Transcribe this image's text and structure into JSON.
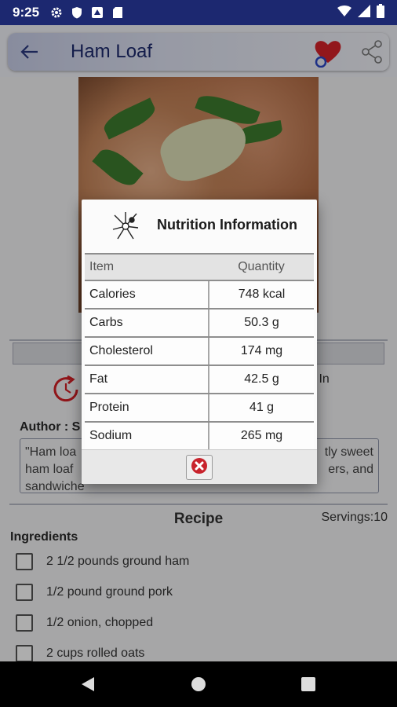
{
  "status": {
    "time": "9:25",
    "icons": [
      "settings-icon",
      "shield-icon",
      "app-notification-icon",
      "sd-card-icon",
      "wifi-icon",
      "signal-icon",
      "battery-icon"
    ]
  },
  "app_bar": {
    "title": "Ham Loaf",
    "back_icon": "back-arrow-icon",
    "favorite_icon": "heart-icon",
    "share_icon": "share-icon"
  },
  "recipe": {
    "author_label": "Author : S",
    "by_in_text": "y In",
    "description_left": "\"Ham loa\nham loaf\nsandwiche",
    "description_right": "tly sweet\ners, and",
    "recipe_heading": "Recipe",
    "servings": "Servings:10",
    "ingredients_heading": "Ingredients",
    "ingredients": [
      "2 1/2 pounds ground ham",
      "1/2 pound ground pork",
      "1/2 onion, chopped",
      "2 cups rolled oats"
    ]
  },
  "dialog": {
    "title": "Nutrition Information",
    "columns": [
      "Item",
      "Quantity"
    ],
    "rows": [
      {
        "item": "Calories",
        "quantity": "748 kcal"
      },
      {
        "item": "Carbs",
        "quantity": "50.3 g"
      },
      {
        "item": "Cholesterol",
        "quantity": "174 mg"
      },
      {
        "item": "Fat",
        "quantity": "42.5 g"
      },
      {
        "item": "Protein",
        "quantity": "41 g"
      },
      {
        "item": "Sodium",
        "quantity": "265 mg"
      }
    ],
    "close_icon": "close-icon"
  },
  "colors": {
    "status_bar": "#1c2870",
    "title_text": "#1d2a6e",
    "heart": "#d8232a",
    "close_red": "#c8232c"
  }
}
